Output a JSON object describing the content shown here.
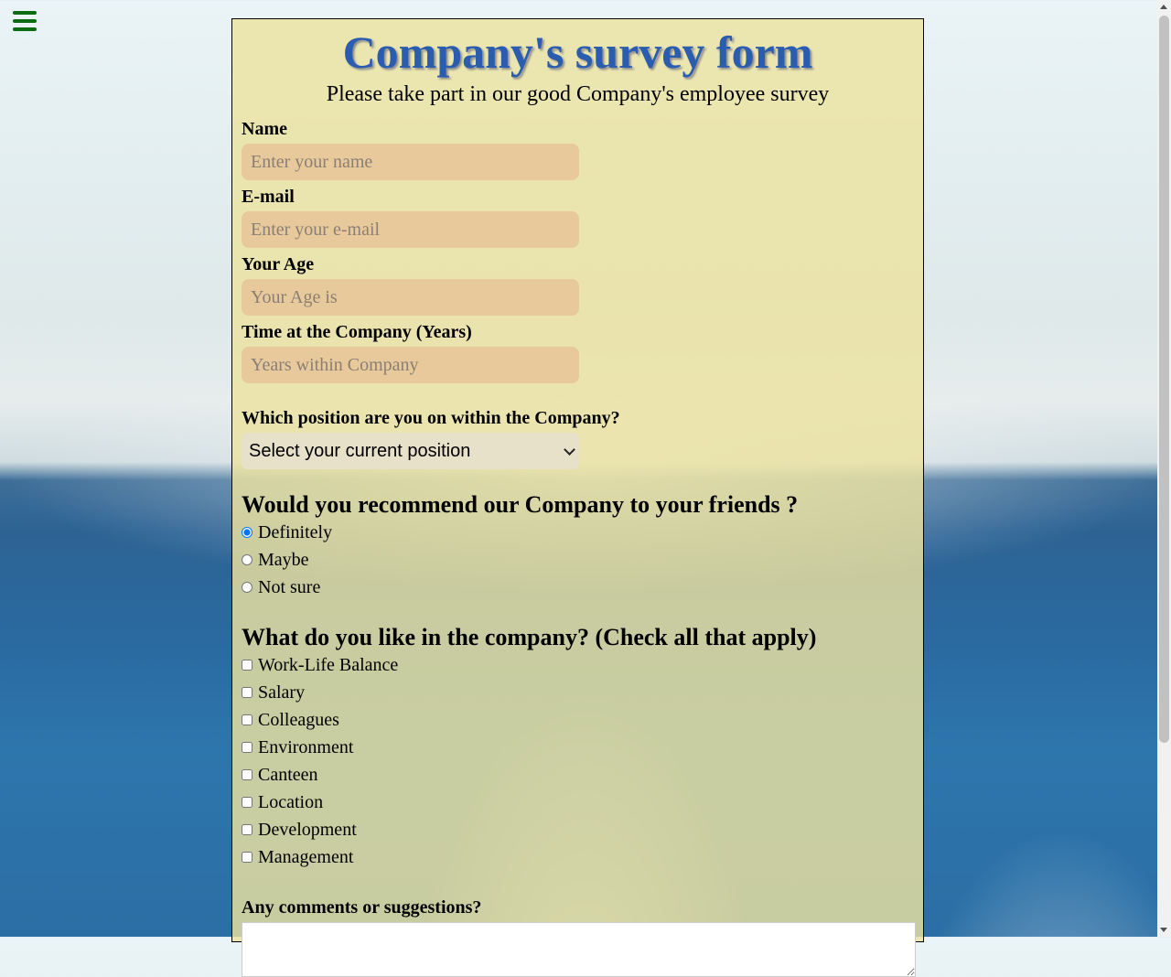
{
  "header": {
    "title": "Company's survey form",
    "subtitle": "Please take part in our good Company's employee survey"
  },
  "fields": {
    "name": {
      "label": "Name",
      "placeholder": "Enter your name",
      "value": ""
    },
    "email": {
      "label": "E-mail",
      "placeholder": "Enter your e-mail",
      "value": ""
    },
    "age": {
      "label": "Your Age",
      "placeholder": "Your Age is",
      "value": ""
    },
    "years": {
      "label": "Time at the Company (Years)",
      "placeholder": "Years within Company",
      "value": ""
    }
  },
  "position": {
    "label": "Which position are you on within the Company?",
    "selected": "Select your current position"
  },
  "recommend": {
    "question": "Would you recommend our Company to your friends ?",
    "options": [
      "Definitely",
      "Maybe",
      "Not sure"
    ],
    "selected": "Definitely"
  },
  "likes": {
    "question": "What do you like in the company? (Check all that apply)",
    "options": [
      "Work-Life Balance",
      "Salary",
      "Colleagues",
      "Environment",
      "Canteen",
      "Location",
      "Development",
      "Management"
    ]
  },
  "comments": {
    "label": "Any comments or suggestions?",
    "value": ""
  },
  "colors": {
    "title": "#2a5db0",
    "menu_icon": "#0b6b10",
    "input_bg": "#e8c99b",
    "panel_bg": "#ece2a0"
  },
  "icons": {
    "menu": "hamburger-menu-icon"
  }
}
